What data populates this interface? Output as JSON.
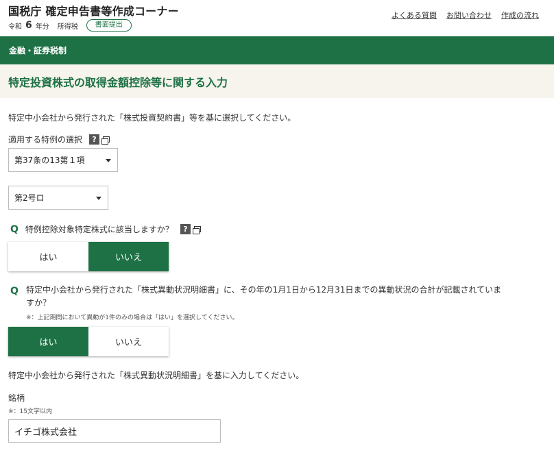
{
  "header": {
    "site_title": "国税庁 確定申告書等作成コーナー",
    "era_prefix": "令和",
    "year": "6",
    "year_suffix": "年分",
    "tax_type": "所得税",
    "mode_badge": "書面提出",
    "links": [
      "よくある質問",
      "お問い合わせ",
      "作成の流れ"
    ]
  },
  "category": "金融・証券税制",
  "page_title": "特定投資株式の取得金額控除等に関する入力",
  "intro_text": "特定中小会社から発行された「株式投資契約書」等を基に選択してください。",
  "special_rule": {
    "label": "適用する特例の選択",
    "help_glyph": "?",
    "select1_value": "第37条の13第１項",
    "select2_value": "第2号ロ"
  },
  "question1": {
    "mark": "Q",
    "text": "特例控除対象特定株式に該当しますか？",
    "help_glyph": "?",
    "yes": "はい",
    "no": "いいえ",
    "selected": "no"
  },
  "question2": {
    "mark": "Q",
    "text_line1": "特定中小会社から発行された「株式異動状況明細書」に、その年の1月1日から12月31日までの異動状況の合計が記載されていま",
    "text_line2": "すか？",
    "note": "※：上記期間において異動が1件のみの場合は「はい」を選択してください。",
    "yes": "はい",
    "no": "いいえ",
    "selected": "yes"
  },
  "input_intro": "特定中小会社から発行された「株式異動状況明細書」を基に入力してください。",
  "stock_name": {
    "label": "銘柄",
    "note": "※：15文字以内",
    "value": "イチゴ株式会社"
  },
  "colors": {
    "brand_green": "#1e7145",
    "title_band": "#f6f4ec"
  }
}
